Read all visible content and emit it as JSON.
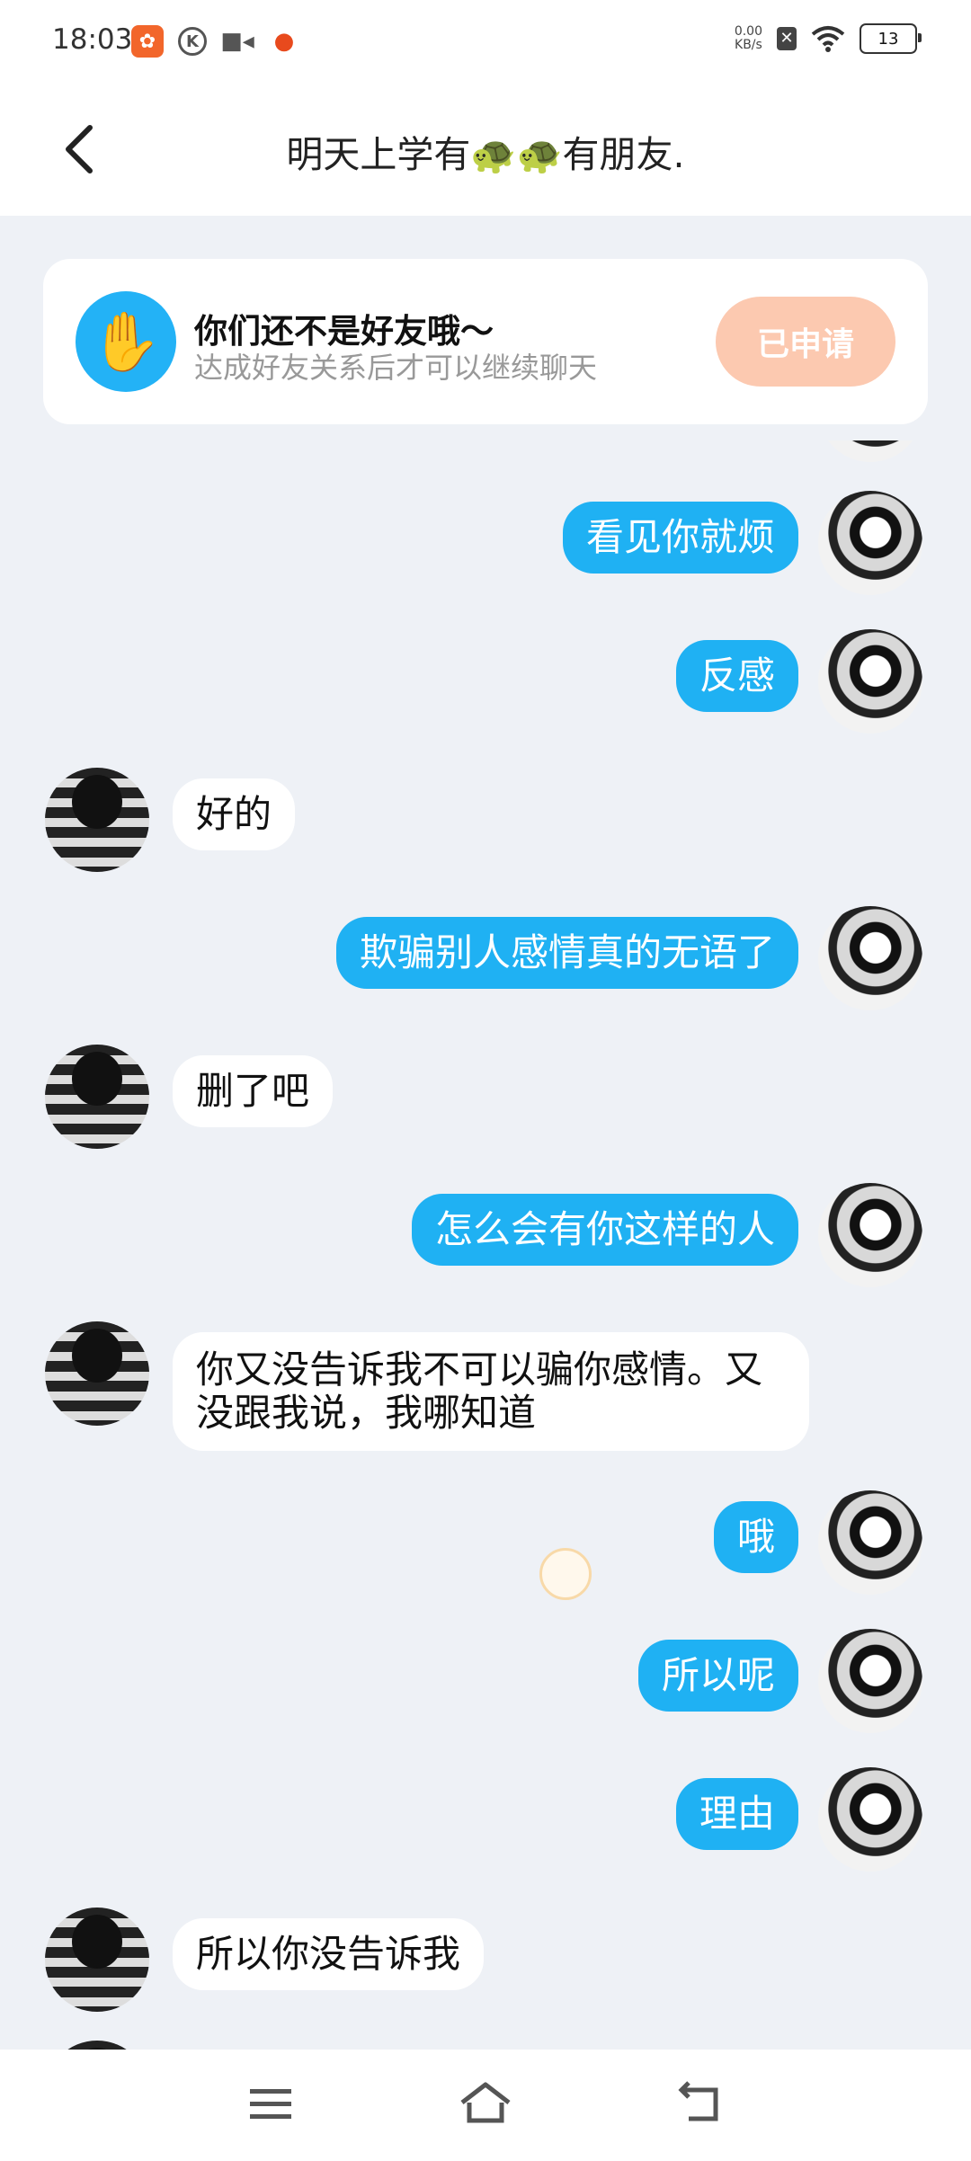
{
  "status_bar": {
    "time": "18:03",
    "net_speed_value": "0.00",
    "net_speed_unit": "KB/s",
    "battery": "13",
    "icons": [
      "app-icon",
      "k-icon",
      "video-icon",
      "game-icon",
      "sim-off-icon",
      "wifi-icon",
      "battery-icon"
    ]
  },
  "header": {
    "title": "明天上学有🐢🐢有朋友."
  },
  "banner": {
    "title": "你们还不是好友哦～",
    "subtitle": "达成好友关系后才可以继续聊天",
    "button_label": "已申请"
  },
  "messages": [
    {
      "sender": "me",
      "text": "看见你就烦"
    },
    {
      "sender": "me",
      "text": "反感"
    },
    {
      "sender": "them",
      "text": "好的"
    },
    {
      "sender": "me",
      "text": "欺骗别人感情真的无语了"
    },
    {
      "sender": "them",
      "text": "删了吧"
    },
    {
      "sender": "me",
      "text": "怎么会有你这样的人"
    },
    {
      "sender": "them",
      "text": "你又没告诉我不可以骗你感情。又没跟我说，我哪知道"
    },
    {
      "sender": "me",
      "text": "哦"
    },
    {
      "sender": "me",
      "text": "所以呢"
    },
    {
      "sender": "me",
      "text": "理由"
    },
    {
      "sender": "them",
      "text": "所以你没告诉我"
    }
  ],
  "colors": {
    "accent": "#1fb1f3",
    "applied_button": "#fcc9b0",
    "background": "#eef1f6"
  }
}
